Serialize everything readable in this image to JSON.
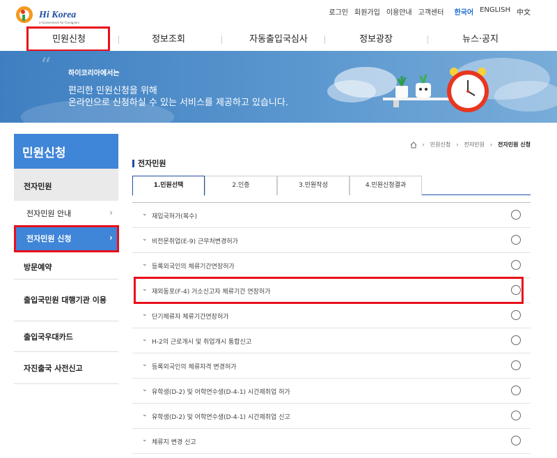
{
  "header": {
    "logo_text": "Hi Korea",
    "logo_sub": "e-Government for Foreigners",
    "util": [
      "로그인",
      "회원가입",
      "이용안내",
      "고객센터"
    ],
    "lang_active": "한국어",
    "lang_en": "ENGLISH",
    "lang_zh": "中文"
  },
  "gnb": [
    "민원신청",
    "정보조회",
    "자동출입국심사",
    "정보광장",
    "뉴스·공지"
  ],
  "banner": {
    "line1": "하이코리아에서는",
    "line2": "편리한 민원신청을 위해",
    "line3": "온라인으로 신청하실 수 있는 서비스를 제공하고 있습니다."
  },
  "sidebar": {
    "title": "민원신청",
    "sub": "전자민원",
    "links": [
      "전자민원 안내",
      "전자민원 신청"
    ],
    "menus": [
      "방문예약",
      "출입국민원 대행기관 이용",
      "출입국우대카드",
      "자진출국 사전신고"
    ]
  },
  "breadcrumb": [
    "민원신청",
    "전자민원",
    "전자민원 신청"
  ],
  "section_title": "전자민원",
  "tabs": [
    "1.민원선택",
    "2.인증",
    "3.민원작성",
    "4.민원신청결과"
  ],
  "items": [
    "재입국허가(복수)",
    "비전문취업(E-9) 근무처변경허가",
    "등록외국인의 체류기간연장허가",
    "재외동포(F-4) 거소신고자 체류기간 연장허가",
    "단기체류자 체류기간연장허가",
    "H-2의 근로개시 및 취업개시 통합신고",
    "등록외국인의 체류자격 변경허가",
    "유학생(D-2) 및 어학연수생(D-4-1) 시간제취업 허가",
    "유학생(D-2) 및 어학연수생(D-4-1) 시간제취업 신고",
    "체류지 변경 신고"
  ],
  "colors": {
    "accent": "#3f85d8",
    "highlight": "#e8101a",
    "brand": "#1f4ea3"
  }
}
